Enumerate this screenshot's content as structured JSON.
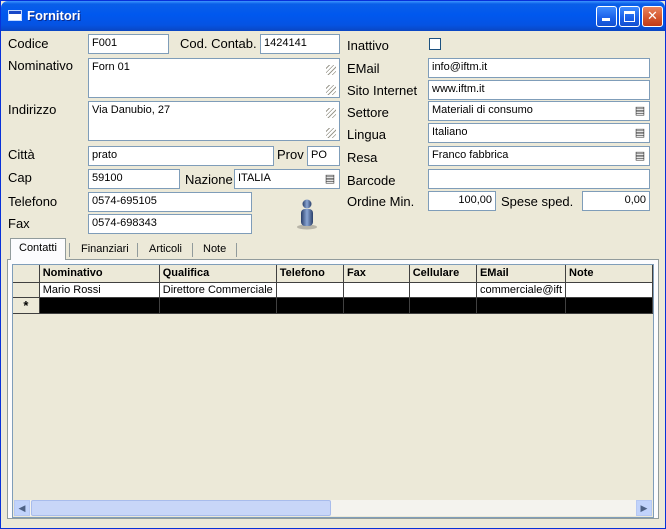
{
  "window": {
    "title": "Fornitori"
  },
  "form": {
    "codice": {
      "label": "Codice",
      "value": "F001"
    },
    "cod_contab": {
      "label": "Cod. Contab.",
      "value": "1424141"
    },
    "nominativo": {
      "label": "Nominativo",
      "value": "Forn 01"
    },
    "indirizzo": {
      "label": "Indirizzo",
      "value": "Via Danubio, 27"
    },
    "citta": {
      "label": "Città",
      "value": "prato"
    },
    "prov": {
      "label": "Prov",
      "value": "PO"
    },
    "cap": {
      "label": "Cap",
      "value": "59100"
    },
    "nazione": {
      "label": "Nazione",
      "value": "ITALIA"
    },
    "telefono": {
      "label": "Telefono",
      "value": "0574-695105"
    },
    "fax": {
      "label": "Fax",
      "value": "0574-698343"
    },
    "inattivo": {
      "label": "Inattivo",
      "checked": false
    },
    "email": {
      "label": "EMail",
      "value": "info@iftm.it"
    },
    "sito": {
      "label": "Sito Internet",
      "value": "www.iftm.it"
    },
    "settore": {
      "label": "Settore",
      "value": "Materiali di consumo"
    },
    "lingua": {
      "label": "Lingua",
      "value": "Italiano"
    },
    "resa": {
      "label": "Resa",
      "value": "Franco fabbrica"
    },
    "barcode": {
      "label": "Barcode",
      "value": ""
    },
    "ordine_min": {
      "label": "Ordine Min.",
      "value": "100,00"
    },
    "spese_sped": {
      "label": "Spese sped.",
      "value": "0,00"
    }
  },
  "tabs": [
    {
      "label": "Contatti",
      "active": true
    },
    {
      "label": "Finanziari",
      "active": false
    },
    {
      "label": "Articoli",
      "active": false
    },
    {
      "label": "Note",
      "active": false
    }
  ],
  "grid": {
    "columns": [
      "Nominativo",
      "Qualifica",
      "Telefono",
      "Fax",
      "Cellulare",
      "EMail",
      "Note"
    ],
    "rows": [
      [
        "Mario Rossi",
        "Direttore Commerciale",
        "",
        "",
        "",
        "commerciale@ift",
        ""
      ]
    ],
    "new_row_marker": "*"
  },
  "icons": {
    "dropdown": "list-dropdown-icon",
    "person": "person-icon"
  }
}
